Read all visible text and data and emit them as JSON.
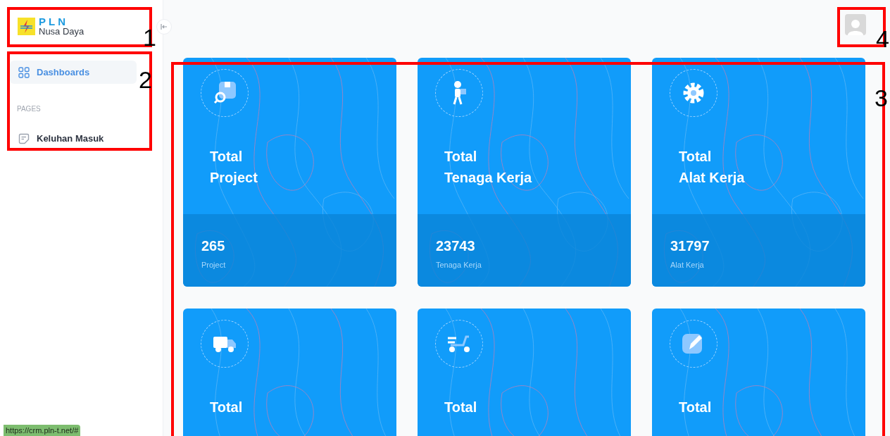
{
  "sidebar": {
    "logo": {
      "title": "PLN",
      "subtitle": "Nusa Daya"
    },
    "items": [
      {
        "kind": "item",
        "label": "Dashboards",
        "selected": true
      },
      {
        "kind": "section",
        "label": "PAGES"
      },
      {
        "kind": "item",
        "label": "Keluhan Masuk",
        "selected": false
      }
    ]
  },
  "cards": [
    {
      "title": [
        "Total",
        "Project"
      ],
      "value": "265",
      "unit": "Project"
    },
    {
      "title": [
        "Total",
        "Tenaga Kerja"
      ],
      "value": "23743",
      "unit": "Tenaga Kerja"
    },
    {
      "title": [
        "Total",
        "Alat Kerja"
      ],
      "value": "31797",
      "unit": "Alat Kerja"
    },
    {
      "title": [
        "Total"
      ]
    },
    {
      "title": [
        "Total"
      ]
    },
    {
      "title": [
        "Total"
      ]
    }
  ],
  "status_url": "https://crm.pln-t.net/#",
  "annotations": [
    {
      "label": "1"
    },
    {
      "label": "4"
    },
    {
      "label": "2"
    },
    {
      "label": "3"
    }
  ]
}
